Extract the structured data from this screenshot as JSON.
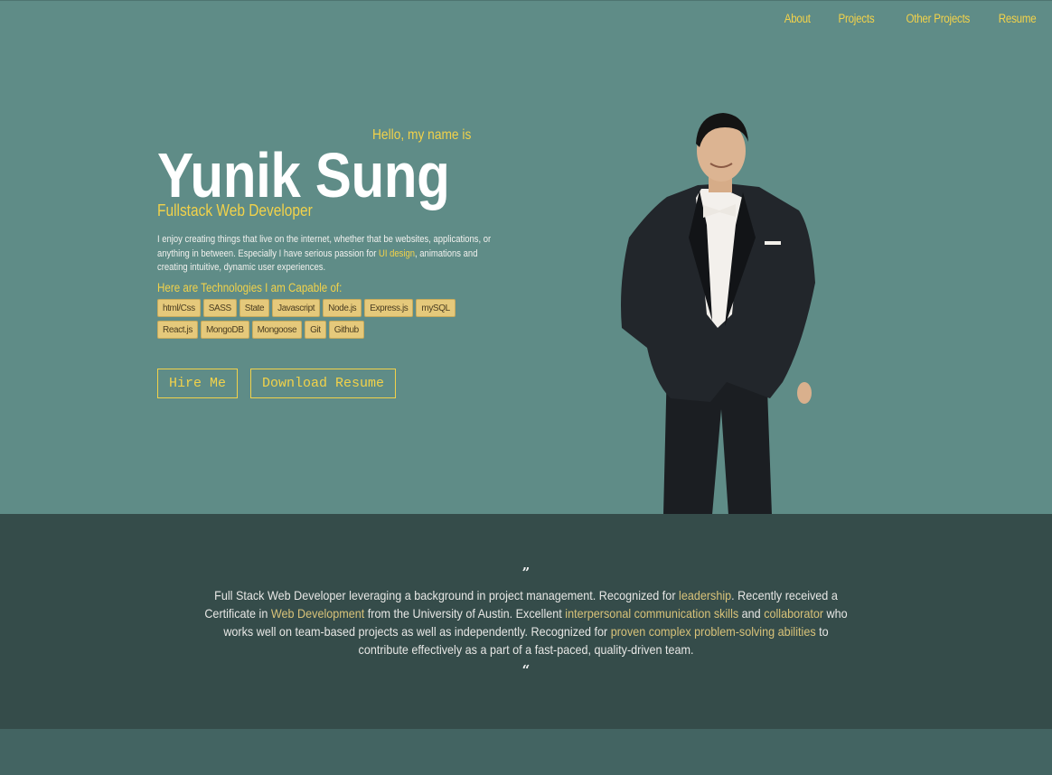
{
  "nav": {
    "items": [
      "About",
      "Projects",
      "Other Projects",
      "Resume"
    ]
  },
  "hero": {
    "greeting": "Hello, my name is",
    "name": "Yunik Sung",
    "role": "Fullstack Web Developer",
    "description_part1": "I enjoy creating things that live on the internet, whether that be websites, applications, or anything in between. Especially I have serious passion for ",
    "description_highlight": "UI design",
    "description_part2": ", animations and creating intuitive, dynamic user experiences.",
    "tech_title": "Here are Technologies I am Capable of:",
    "tech_row1": [
      "html/Css",
      "SASS",
      "State",
      "Javascript",
      "Node.js",
      "Express.js",
      "mySQL"
    ],
    "tech_row2": [
      "React.js",
      "MongoDB",
      "Mongoose",
      "Git",
      "Github"
    ],
    "hire_label": "Hire Me",
    "resume_label": "Download Resume"
  },
  "quote": {
    "open_mark": "”",
    "close_mark": "“",
    "t1": "Full Stack Web Developer leveraging a background in project management. Recognized for ",
    "h1": "leadership",
    "t2": ". Recently received a Certificate in ",
    "h2": "Web Development",
    "t3": " from the University of Austin. Excellent ",
    "h3": "interpersonal communication skills",
    "t4": " and ",
    "h4": "collaborator",
    "t5": " who works well on team-based projects as well as independently. Recognized for ",
    "h5": "proven complex problem-solving abilities",
    "t6": " to contribute effectively as a part of a fast-paced, quality-driven team."
  },
  "colors": {
    "hero_bg": "#5f8c87",
    "accent": "#f2d24a",
    "quote_bg": "#354c4a",
    "footer_bg": "#436462",
    "tag_bg": "#e5c97b"
  }
}
